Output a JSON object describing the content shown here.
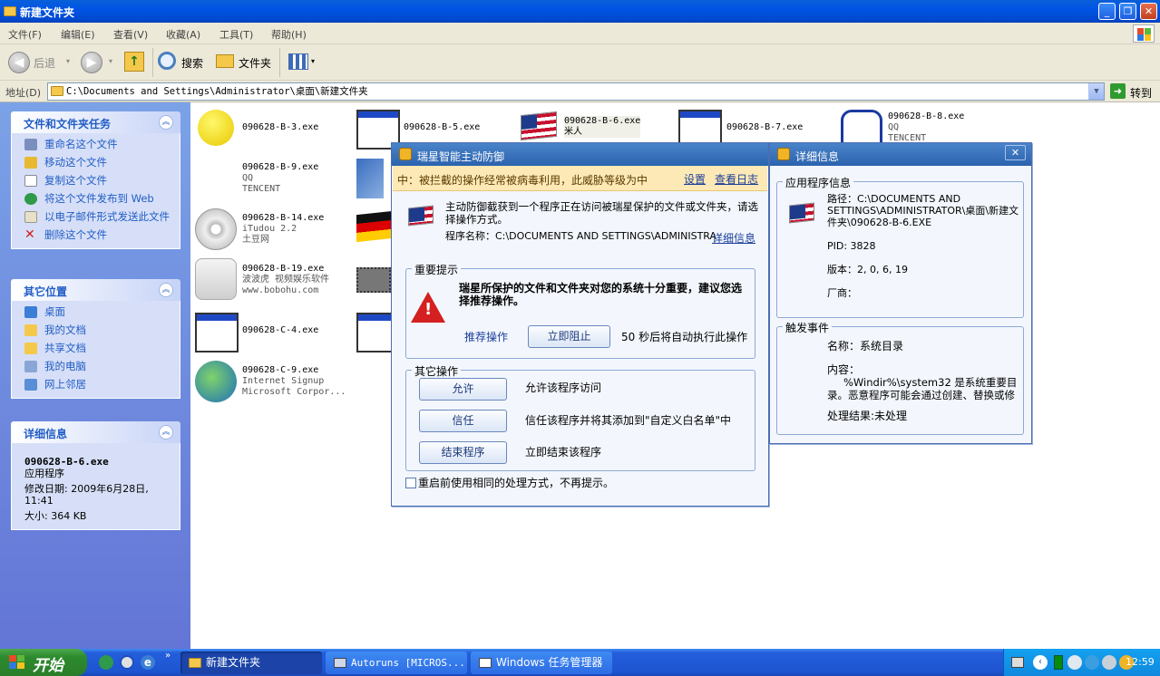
{
  "window": {
    "title": "新建文件夹"
  },
  "menu": [
    "文件(F)",
    "编辑(E)",
    "查看(V)",
    "收藏(A)",
    "工具(T)",
    "帮助(H)"
  ],
  "toolbar": {
    "back": "后退",
    "search": "搜索",
    "folders": "文件夹"
  },
  "address": {
    "label": "地址(D)",
    "path": "C:\\Documents and Settings\\Administrator\\桌面\\新建文件夹",
    "go": "转到"
  },
  "sidebar": {
    "tasks": {
      "title": "文件和文件夹任务",
      "items": [
        "重命名这个文件",
        "移动这个文件",
        "复制这个文件",
        "将这个文件发布到 Web",
        "以电子邮件形式发送此文件",
        "删除这个文件"
      ]
    },
    "places": {
      "title": "其它位置",
      "items": [
        "桌面",
        "我的文档",
        "共享文档",
        "我的电脑",
        "网上邻居"
      ]
    },
    "details": {
      "title": "详细信息",
      "filename": "090628-B-6.exe",
      "type": "应用程序",
      "modified": "修改日期: 2009年6月28日, 11:41",
      "size": "大小: 364 KB"
    }
  },
  "files": [
    {
      "name": "090628-B-3.exe",
      "line2": "",
      "line3": ""
    },
    {
      "name": "090628-B-5.exe",
      "line2": "",
      "line3": ""
    },
    {
      "name": "090628-B-6.exe",
      "line2": "米人",
      "line3": ""
    },
    {
      "name": "090628-B-7.exe",
      "line2": "",
      "line3": ""
    },
    {
      "name": "090628-B-8.exe",
      "line2": "QQ",
      "line3": "TENCENT"
    },
    {
      "name": "090628-B-9.exe",
      "line2": "QQ",
      "line3": "TENCENT"
    },
    {
      "name": "090628-B-14.exe",
      "line2": "iTudou 2.2",
      "line3": "土豆网"
    },
    {
      "name": "090628-B-19.exe",
      "line2": "波波虎 视频娱乐软件",
      "line3": "www.bobohu.com"
    },
    {
      "name": "090628-C-4.exe",
      "line2": "",
      "line3": ""
    },
    {
      "name": "090628-C-9.exe",
      "line2": "Internet Signup",
      "line3": "Microsoft Corpor..."
    }
  ],
  "rising": {
    "title": "瑞星智能主动防御",
    "warning": "中：被拦截的操作经常被病毒利用，此威胁等级为中",
    "settings": "设置",
    "viewlog": "查看日志",
    "message": "主动防御截获到一个程序正在访问被瑞星保护的文件或文件夹，请选择操作方式。",
    "program": "程序名称：C:\\DOCUMENTS AND SETTINGS\\ADMINISTRA",
    "details_link": "详细信息",
    "important_label": "重要提示",
    "important_text": "瑞星所保护的文件和文件夹对您的系统十分重要，建议您选择推荐操作。",
    "recommend": "推荐操作",
    "block": "立即阻止",
    "countdown": "50 秒后将自动执行此操作",
    "other_label": "其它操作",
    "allow": "允许",
    "allow_desc": "允许该程序访问",
    "trust": "信任",
    "trust_desc": "信任该程序并将其添加到\"自定义白名单\"中",
    "kill": "结束程序",
    "kill_desc": "立即结束该程序",
    "remember": "重启前使用相同的处理方式，不再提示。"
  },
  "detail": {
    "title": "详细信息",
    "app_label": "应用程序信息",
    "path": "路径：C:\\DOCUMENTS AND SETTINGS\\ADMINISTRATOR\\桌面\\新建文件夹\\090628-B-6.EXE",
    "pid": "PID: 3828",
    "version": "版本：2, 0, 6, 19",
    "vendor": "厂商：",
    "event_label": "触发事件",
    "event_name": "名称：系统目录",
    "content_label": "内容：",
    "content": "%Windir%\\system32 是系统重要目录。恶意程序可能会通过创建、替换或修",
    "result": "处理结果:未处理"
  },
  "taskbar": {
    "start": "开始",
    "items": [
      "新建文件夹",
      "Autoruns [MICROS...",
      "Windows 任务管理器"
    ],
    "clock": "12:59"
  }
}
